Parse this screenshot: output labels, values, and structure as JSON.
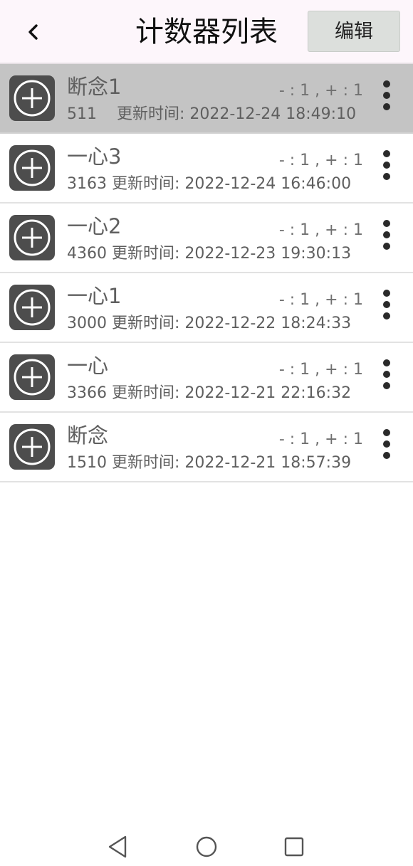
{
  "header": {
    "title": "计数器列表",
    "back_icon": "chevron-left-icon",
    "edit_label": "编辑"
  },
  "counters": [
    {
      "name": "断念1",
      "step": "- : 1 , + : 1",
      "count": "511",
      "updated_label": "更新时间:",
      "updated": "2022-12-24 18:49:10",
      "selected": true
    },
    {
      "name": "一心3",
      "step": "- : 1 , + : 1",
      "count": "3163",
      "updated_label": "更新时间:",
      "updated": "2022-12-24 16:46:00",
      "selected": false
    },
    {
      "name": "一心2",
      "step": "- : 1 , + : 1",
      "count": "4360",
      "updated_label": "更新时间:",
      "updated": "2022-12-23 19:30:13",
      "selected": false
    },
    {
      "name": "一心1",
      "step": "- : 1 , + : 1",
      "count": "3000",
      "updated_label": "更新时间:",
      "updated": "2022-12-22 18:24:33",
      "selected": false
    },
    {
      "name": "一心",
      "step": "- : 1 , + : 1",
      "count": "3366",
      "updated_label": "更新时间:",
      "updated": "2022-12-21 22:16:32",
      "selected": false
    },
    {
      "name": "断念",
      "step": "- : 1 , + : 1",
      "count": "1510",
      "updated_label": "更新时间:",
      "updated": "2022-12-21 18:57:39",
      "selected": false
    }
  ],
  "icons": {
    "add": "plus-circle-icon",
    "more": "more-vertical-icon",
    "nav_back": "triangle-back-icon",
    "nav_home": "circle-home-icon",
    "nav_recents": "square-recents-icon"
  },
  "colors": {
    "header_bg": "#fdf6fb",
    "selected_row": "#c4c4c4",
    "add_button": "#4d4d4d",
    "edit_button": "#dcdfdc"
  }
}
